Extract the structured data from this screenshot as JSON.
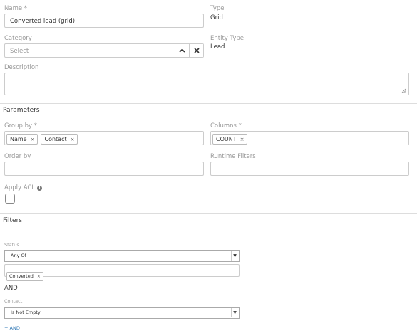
{
  "fields": {
    "name": {
      "label": "Name *",
      "value": "Converted lead (grid)"
    },
    "type": {
      "label": "Type",
      "value": "Grid"
    },
    "category": {
      "label": "Category",
      "placeholder": "Select"
    },
    "entity_type": {
      "label": "Entity Type",
      "value": "Lead"
    },
    "description": {
      "label": "Description",
      "value": ""
    }
  },
  "parameters": {
    "title": "Parameters",
    "group_by": {
      "label": "Group by *",
      "tags": [
        "Name",
        "Contact"
      ]
    },
    "columns": {
      "label": "Columns *",
      "tags": [
        "COUNT"
      ]
    },
    "order_by": {
      "label": "Order by"
    },
    "runtime_filters": {
      "label": "Runtime Filters"
    },
    "apply_acl": {
      "label": "Apply ACL",
      "checked": false
    }
  },
  "filters": {
    "title": "Filters",
    "status": {
      "label": "Status",
      "operator": "Any Of",
      "tags": [
        "Converted"
      ]
    },
    "and_text": "AND",
    "contact": {
      "label": "Contact",
      "operator": "Is Not Empty"
    },
    "add_and": "+ AND"
  },
  "icons": {
    "remove": "×",
    "caret_up": "▲",
    "caret_down": "▼",
    "info": "i"
  }
}
